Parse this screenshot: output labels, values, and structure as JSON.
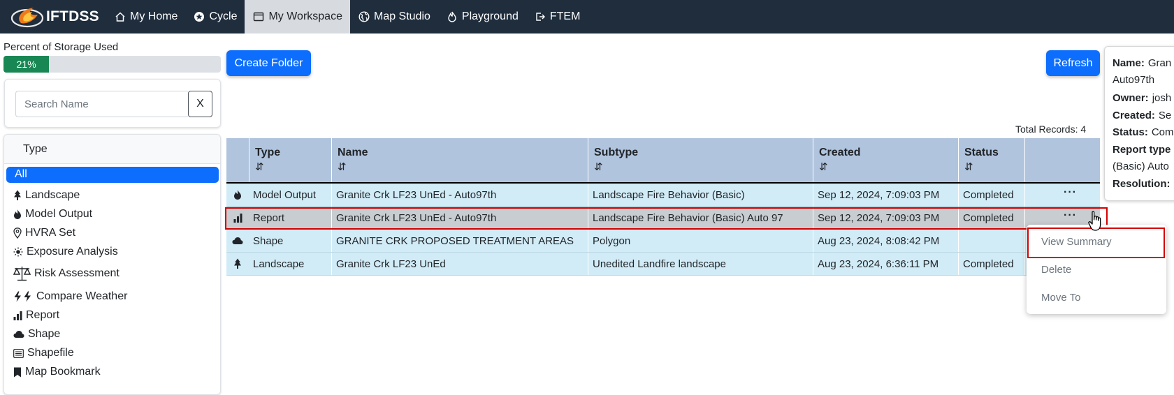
{
  "app": {
    "brand": "IFTDSS",
    "nav": [
      {
        "label": "My Home",
        "icon": "home-icon"
      },
      {
        "label": "Cycle",
        "icon": "cycle-icon"
      },
      {
        "label": "My Workspace",
        "icon": "window-icon",
        "active": true
      },
      {
        "label": "Map Studio",
        "icon": "globe-icon"
      },
      {
        "label": "Playground",
        "icon": "fire-icon"
      },
      {
        "label": "FTEM",
        "icon": "exit-icon"
      }
    ]
  },
  "sidebar": {
    "storage_label": "Percent of Storage Used",
    "storage_percent": 21,
    "storage_text": "21%",
    "search_placeholder": "Search Name",
    "search_clear": "X",
    "type_header": "Type",
    "types": [
      {
        "label": "All",
        "selected": true
      },
      {
        "label": "Landscape",
        "icon": "tree-icon"
      },
      {
        "label": "Model Output",
        "icon": "fire-icon"
      },
      {
        "label": "HVRA Set",
        "icon": "map-pin-icon"
      },
      {
        "label": "Exposure Analysis",
        "icon": "sun-icon"
      },
      {
        "label": "Risk Assessment",
        "icon": "scale-icon"
      },
      {
        "label": "Compare Weather",
        "icon": "lightning-icon"
      },
      {
        "label": "Report",
        "icon": "bar-chart-icon"
      },
      {
        "label": "Shape",
        "icon": "cloud-icon"
      },
      {
        "label": "Shapefile",
        "icon": "list-icon"
      },
      {
        "label": "Map Bookmark",
        "icon": "bookmark-icon"
      }
    ]
  },
  "toolbar": {
    "create_folder": "Create Folder",
    "refresh": "Refresh",
    "total_records": "Total Records: 4"
  },
  "table": {
    "sort_glyph": "⇵",
    "columns": [
      "Type",
      "Name",
      "Subtype",
      "Created",
      "Status"
    ],
    "row_menu_glyph": "···",
    "rows": [
      {
        "icon": "fire-icon",
        "type": "Model Output",
        "name": "Granite Crk LF23 UnEd - Auto97th",
        "subtype": "Landscape Fire Behavior (Basic)",
        "created": "Sep 12, 2024, 7:09:03 PM",
        "status": "Completed"
      },
      {
        "icon": "bar-chart-icon",
        "type": "Report",
        "name": "Granite Crk LF23 UnEd - Auto97th",
        "subtype": "Landscape Fire Behavior (Basic) Auto 97",
        "created": "Sep 12, 2024, 7:09:03 PM",
        "status": "Completed",
        "selected": true
      },
      {
        "icon": "cloud-icon",
        "type": "Shape",
        "name": "GRANITE CRK PROPOSED TREATMENT AREAS",
        "subtype": "Polygon",
        "created": "Aug 23, 2024, 8:08:42 PM",
        "status": ""
      },
      {
        "icon": "tree-icon",
        "type": "Landscape",
        "name": "Granite Crk LF23 UnEd",
        "subtype": "Unedited Landfire landscape",
        "created": "Aug 23, 2024, 6:36:11 PM",
        "status": "Completed"
      }
    ]
  },
  "row_menu": {
    "items": [
      "View Summary",
      "Delete",
      "Move To"
    ]
  },
  "popover": {
    "lines": [
      {
        "key": "Name:",
        "value": "Gran"
      },
      {
        "key": "",
        "value": "Auto97th"
      },
      {
        "key": "Owner:",
        "value": "josh"
      },
      {
        "key": "Created:",
        "value": "Se"
      },
      {
        "key": "Status:",
        "value": "Com"
      },
      {
        "key": "Report type",
        "value": ""
      },
      {
        "key": "",
        "value": "(Basic) Auto"
      },
      {
        "key": "Resolution:",
        "value": ""
      }
    ]
  },
  "colors": {
    "navbar": "#1f2d3d",
    "primary": "#0d6efd",
    "storage_fill": "#198754",
    "table_header": "#b0c4de",
    "row": "#d1ecf7",
    "row_selected": "#c8cdd1",
    "highlight": "#d40000"
  }
}
